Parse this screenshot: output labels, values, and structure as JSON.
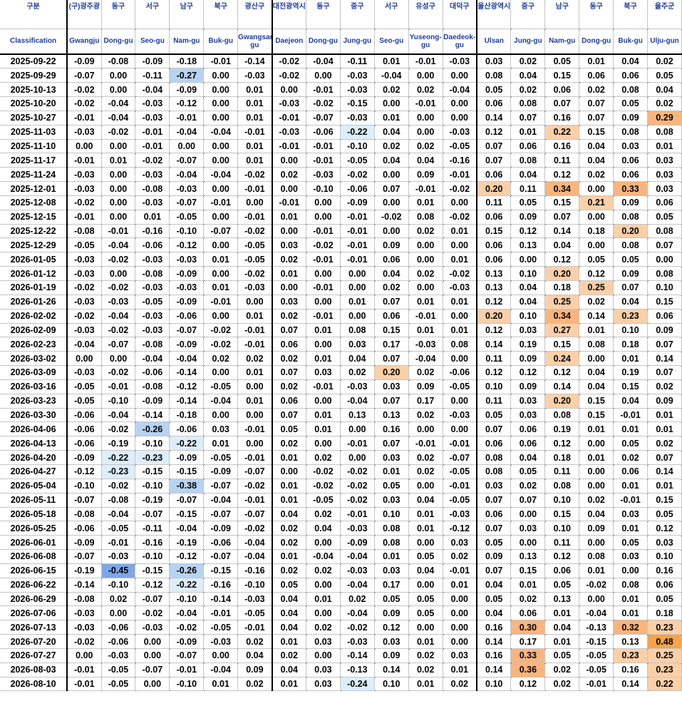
{
  "header_ko": [
    "구분",
    "(구)광주광",
    "동구",
    "서구",
    "남구",
    "북구",
    "광산구",
    "대전광역시",
    "동구",
    "중구",
    "서구",
    "유성구",
    "대덕구",
    "울산광역시",
    "중구",
    "남구",
    "동구",
    "북구",
    "울주군"
  ],
  "header_en": [
    "Classification",
    "Gwangju",
    "Dong-gu",
    "Seo-gu",
    "Nam-gu",
    "Buk-gu",
    "Gwangsan-gu",
    "Daejeon",
    "Dong-gu",
    "Jung-gu",
    "Seo-gu",
    "Yuseong-gu",
    "Daedeok-gu",
    "Ulsan",
    "Jung-gu",
    "Nam-gu",
    "Dong-gu",
    "Buk-gu",
    "Ulju-gun"
  ],
  "rows": [
    [
      "2025-09-22",
      "-0.09",
      "-0.08",
      "-0.09",
      "-0.18",
      "-0.01",
      "-0.14",
      "-0.02",
      "-0.04",
      "-0.11",
      "0.01",
      "-0.01",
      "-0.03",
      "0.03",
      "0.02",
      "0.05",
      "0.01",
      "0.04",
      "0.02"
    ],
    [
      "2025-09-29",
      "-0.07",
      "0.00",
      "-0.11",
      "-0.27",
      "0.00",
      "-0.03",
      "-0.02",
      "0.00",
      "-0.03",
      "-0.04",
      "0.00",
      "0.00",
      "0.08",
      "0.04",
      "0.15",
      "0.06",
      "0.06",
      "0.05"
    ],
    [
      "2025-10-13",
      "-0.02",
      "0.00",
      "-0.04",
      "-0.09",
      "0.00",
      "0.01",
      "0.00",
      "-0.01",
      "-0.03",
      "0.02",
      "0.02",
      "-0.04",
      "0.05",
      "0.02",
      "0.06",
      "0.02",
      "0.08",
      "0.04"
    ],
    [
      "2025-10-20",
      "-0.02",
      "-0.04",
      "-0.03",
      "-0.12",
      "0.00",
      "0.01",
      "-0.03",
      "-0.02",
      "-0.15",
      "0.00",
      "-0.01",
      "0.00",
      "0.06",
      "0.08",
      "0.07",
      "0.07",
      "0.05",
      "0.02"
    ],
    [
      "2025-10-27",
      "-0.01",
      "-0.04",
      "-0.03",
      "-0.01",
      "0.00",
      "0.01",
      "-0.01",
      "-0.07",
      "-0.03",
      "0.01",
      "0.00",
      "0.00",
      "0.14",
      "0.07",
      "0.16",
      "0.07",
      "0.09",
      "0.29"
    ],
    [
      "2025-11-03",
      "-0.03",
      "-0.02",
      "-0.01",
      "-0.04",
      "-0.04",
      "-0.01",
      "-0.03",
      "-0.06",
      "-0.22",
      "0.04",
      "0.00",
      "-0.03",
      "0.12",
      "0.01",
      "0.22",
      "0.15",
      "0.08",
      "0.08"
    ],
    [
      "2025-11-10",
      "0.00",
      "0.00",
      "-0.01",
      "0.00",
      "0.00",
      "0.01",
      "-0.01",
      "-0.01",
      "-0.10",
      "0.02",
      "0.02",
      "-0.05",
      "0.07",
      "0.06",
      "0.16",
      "0.04",
      "0.03",
      "0.01"
    ],
    [
      "2025-11-17",
      "-0.01",
      "0.01",
      "-0.02",
      "-0.07",
      "0.00",
      "0.01",
      "0.00",
      "-0.01",
      "-0.05",
      "0.04",
      "0.04",
      "-0.16",
      "0.07",
      "0.08",
      "0.11",
      "0.04",
      "0.06",
      "0.03"
    ],
    [
      "2025-11-24",
      "-0.03",
      "0.00",
      "-0.03",
      "-0.04",
      "-0.04",
      "-0.02",
      "0.02",
      "-0.03",
      "-0.02",
      "0.00",
      "0.09",
      "-0.01",
      "0.06",
      "0.04",
      "0.12",
      "0.02",
      "0.06",
      "0.03"
    ],
    [
      "2025-12-01",
      "-0.03",
      "0.00",
      "-0.08",
      "-0.03",
      "0.00",
      "-0.01",
      "0.00",
      "-0.10",
      "-0.06",
      "0.07",
      "-0.01",
      "-0.02",
      "0.20",
      "0.11",
      "0.34",
      "0.00",
      "0.33",
      "0.03"
    ],
    [
      "2025-12-08",
      "-0.02",
      "0.00",
      "-0.03",
      "-0.07",
      "-0.01",
      "0.00",
      "-0.01",
      "0.00",
      "-0.09",
      "0.00",
      "0.01",
      "0.00",
      "0.11",
      "0.05",
      "0.15",
      "0.21",
      "0.09",
      "0.06"
    ],
    [
      "2025-12-15",
      "-0.01",
      "0.00",
      "0.01",
      "-0.05",
      "0.00",
      "-0.01",
      "0.01",
      "0.00",
      "-0.01",
      "-0.02",
      "0.08",
      "-0.02",
      "0.06",
      "0.09",
      "0.07",
      "0.00",
      "0.08",
      "0.05"
    ],
    [
      "2025-12-22",
      "-0.08",
      "-0.01",
      "-0.16",
      "-0.10",
      "-0.07",
      "-0.02",
      "0.00",
      "-0.01",
      "-0.01",
      "0.00",
      "0.02",
      "0.01",
      "0.15",
      "0.12",
      "0.14",
      "0.18",
      "0.20",
      "0.08"
    ],
    [
      "2025-12-29",
      "-0.05",
      "-0.04",
      "-0.06",
      "-0.12",
      "0.00",
      "-0.05",
      "0.03",
      "-0.02",
      "-0.01",
      "0.09",
      "0.00",
      "0.00",
      "0.06",
      "0.13",
      "0.04",
      "0.00",
      "0.08",
      "0.07"
    ],
    [
      "2026-01-05",
      "-0.03",
      "-0.02",
      "-0.03",
      "-0.03",
      "0.01",
      "-0.05",
      "0.02",
      "-0.01",
      "-0.01",
      "0.06",
      "0.00",
      "0.01",
      "0.06",
      "0.00",
      "0.12",
      "0.05",
      "0.05",
      "0.00"
    ],
    [
      "2026-01-12",
      "-0.03",
      "0.00",
      "-0.08",
      "-0.09",
      "0.00",
      "-0.02",
      "0.01",
      "0.00",
      "0.00",
      "0.04",
      "0.02",
      "-0.02",
      "0.13",
      "0.10",
      "0.20",
      "0.12",
      "0.09",
      "0.08"
    ],
    [
      "2026-01-19",
      "-0.02",
      "-0.02",
      "-0.03",
      "-0.03",
      "0.01",
      "-0.03",
      "0.00",
      "-0.01",
      "0.00",
      "0.02",
      "0.00",
      "-0.03",
      "0.13",
      "0.04",
      "0.18",
      "0.25",
      "0.07",
      "0.10"
    ],
    [
      "2026-01-26",
      "-0.03",
      "-0.03",
      "-0.05",
      "-0.09",
      "-0.01",
      "0.00",
      "0.03",
      "0.00",
      "0.01",
      "0.07",
      "0.01",
      "0.01",
      "0.12",
      "0.04",
      "0.25",
      "0.02",
      "0.04",
      "0.15"
    ],
    [
      "2026-02-02",
      "-0.02",
      "-0.04",
      "-0.03",
      "-0.06",
      "0.00",
      "0.01",
      "0.02",
      "-0.01",
      "0.00",
      "0.06",
      "-0.01",
      "0.00",
      "0.20",
      "0.10",
      "0.34",
      "0.14",
      "0.23",
      "0.06"
    ],
    [
      "2026-02-09",
      "-0.03",
      "-0.02",
      "-0.03",
      "-0.07",
      "-0.02",
      "-0.01",
      "0.07",
      "0.01",
      "0.08",
      "0.15",
      "0.01",
      "0.01",
      "0.12",
      "0.03",
      "0.27",
      "0.01",
      "0.10",
      "0.09"
    ],
    [
      "2026-02-23",
      "-0.04",
      "-0.07",
      "-0.08",
      "-0.09",
      "-0.02",
      "-0.01",
      "0.06",
      "0.00",
      "0.03",
      "0.17",
      "-0.03",
      "0.08",
      "0.14",
      "0.19",
      "0.15",
      "0.08",
      "0.18",
      "0.07"
    ],
    [
      "2026-03-02",
      "0.00",
      "0.00",
      "-0.04",
      "-0.04",
      "0.02",
      "0.02",
      "0.02",
      "0.01",
      "0.04",
      "0.07",
      "-0.04",
      "0.00",
      "0.11",
      "0.09",
      "0.24",
      "0.00",
      "0.01",
      "0.14"
    ],
    [
      "2026-03-09",
      "-0.03",
      "-0.02",
      "-0.06",
      "-0.14",
      "0.00",
      "0.01",
      "0.07",
      "0.03",
      "0.02",
      "0.20",
      "0.02",
      "-0.06",
      "0.12",
      "0.12",
      "0.12",
      "0.04",
      "0.19",
      "0.07"
    ],
    [
      "2026-03-16",
      "-0.05",
      "-0.01",
      "-0.08",
      "-0.12",
      "-0.05",
      "0.00",
      "0.02",
      "-0.01",
      "-0.03",
      "0.03",
      "0.09",
      "-0.05",
      "0.10",
      "0.09",
      "0.14",
      "0.04",
      "0.15",
      "0.02"
    ],
    [
      "2026-03-23",
      "-0.05",
      "-0.10",
      "-0.09",
      "-0.14",
      "-0.04",
      "0.01",
      "0.06",
      "0.00",
      "-0.04",
      "0.07",
      "0.17",
      "0.00",
      "0.11",
      "0.03",
      "0.20",
      "0.15",
      "0.04",
      "0.09"
    ],
    [
      "2026-03-30",
      "-0.06",
      "-0.04",
      "-0.14",
      "-0.18",
      "0.00",
      "0.00",
      "0.07",
      "0.01",
      "0.13",
      "0.13",
      "0.02",
      "-0.03",
      "0.05",
      "0.03",
      "0.08",
      "0.15",
      "-0.01",
      "0.01"
    ],
    [
      "2026-04-06",
      "-0.06",
      "-0.02",
      "-0.26",
      "-0.06",
      "0.03",
      "-0.01",
      "0.05",
      "0.01",
      "0.00",
      "0.16",
      "0.00",
      "0.00",
      "0.07",
      "0.06",
      "0.19",
      "0.01",
      "0.01",
      "0.01"
    ],
    [
      "2026-04-13",
      "-0.06",
      "-0.19",
      "-0.10",
      "-0.22",
      "0.01",
      "0.00",
      "0.02",
      "0.00",
      "-0.01",
      "0.07",
      "-0.01",
      "-0.01",
      "0.06",
      "0.06",
      "0.12",
      "0.00",
      "0.05",
      "0.02"
    ],
    [
      "2026-04-20",
      "-0.09",
      "-0.22",
      "-0.23",
      "-0.09",
      "-0.05",
      "-0.01",
      "0.01",
      "0.02",
      "0.00",
      "0.03",
      "0.02",
      "-0.07",
      "0.08",
      "0.04",
      "0.18",
      "0.01",
      "0.02",
      "0.07"
    ],
    [
      "2026-04-27",
      "-0.12",
      "-0.23",
      "-0.15",
      "-0.15",
      "-0.09",
      "-0.07",
      "0.00",
      "-0.02",
      "-0.02",
      "0.01",
      "0.02",
      "-0.05",
      "0.08",
      "0.05",
      "0.11",
      "0.00",
      "0.06",
      "0.14"
    ],
    [
      "2026-05-04",
      "-0.10",
      "-0.02",
      "-0.10",
      "-0.38",
      "-0.07",
      "-0.02",
      "0.01",
      "-0.02",
      "-0.02",
      "0.05",
      "0.00",
      "-0.01",
      "0.03",
      "0.02",
      "0.08",
      "0.00",
      "0.01",
      "0.01"
    ],
    [
      "2026-05-11",
      "-0.07",
      "-0.08",
      "-0.19",
      "-0.07",
      "-0.04",
      "-0.01",
      "0.01",
      "-0.05",
      "-0.02",
      "0.03",
      "0.04",
      "-0.05",
      "0.07",
      "0.07",
      "0.10",
      "0.02",
      "-0.01",
      "0.15"
    ],
    [
      "2026-05-18",
      "-0.08",
      "-0.04",
      "-0.07",
      "-0.15",
      "-0.07",
      "-0.07",
      "0.04",
      "0.02",
      "-0.01",
      "0.10",
      "0.01",
      "-0.03",
      "0.06",
      "0.00",
      "0.15",
      "0.04",
      "0.03",
      "0.05"
    ],
    [
      "2026-05-25",
      "-0.06",
      "-0.05",
      "-0.11",
      "-0.04",
      "-0.09",
      "-0.02",
      "0.02",
      "0.04",
      "-0.03",
      "0.08",
      "0.01",
      "-0.12",
      "0.07",
      "0.03",
      "0.10",
      "0.09",
      "0.01",
      "0.12"
    ],
    [
      "2026-06-01",
      "-0.09",
      "-0.01",
      "-0.16",
      "-0.19",
      "-0.06",
      "-0.04",
      "0.02",
      "0.00",
      "-0.09",
      "0.08",
      "0.00",
      "0.03",
      "0.05",
      "0.00",
      "0.11",
      "0.00",
      "0.05",
      "0.03"
    ],
    [
      "2026-06-08",
      "-0.07",
      "-0.03",
      "-0.10",
      "-0.12",
      "-0.07",
      "-0.04",
      "0.01",
      "-0.04",
      "-0.04",
      "0.01",
      "0.05",
      "0.02",
      "0.09",
      "0.13",
      "0.12",
      "0.08",
      "0.03",
      "0.10"
    ],
    [
      "2026-06-15",
      "-0.19",
      "-0.45",
      "-0.15",
      "-0.26",
      "-0.15",
      "-0.16",
      "0.02",
      "0.02",
      "-0.03",
      "0.03",
      "0.04",
      "-0.01",
      "0.07",
      "0.15",
      "0.06",
      "0.01",
      "0.00",
      "0.16"
    ],
    [
      "2026-06-22",
      "-0.14",
      "-0.10",
      "-0.12",
      "-0.22",
      "-0.16",
      "-0.10",
      "0.05",
      "0.00",
      "-0.04",
      "0.17",
      "0.00",
      "0.01",
      "0.04",
      "0.01",
      "0.05",
      "-0.02",
      "0.08",
      "0.06"
    ],
    [
      "2026-06-29",
      "-0.08",
      "0.02",
      "-0.07",
      "-0.10",
      "-0.14",
      "-0.03",
      "0.04",
      "0.01",
      "0.02",
      "0.05",
      "0.05",
      "0.00",
      "0.05",
      "0.02",
      "0.13",
      "0.00",
      "0.01",
      "0.05"
    ],
    [
      "2026-07-06",
      "-0.03",
      "0.00",
      "-0.02",
      "-0.04",
      "-0.01",
      "-0.05",
      "0.04",
      "0.00",
      "-0.04",
      "0.09",
      "0.05",
      "0.00",
      "0.04",
      "0.06",
      "0.01",
      "-0.04",
      "0.01",
      "0.18"
    ],
    [
      "2026-07-13",
      "-0.03",
      "-0.06",
      "-0.03",
      "-0.02",
      "-0.05",
      "-0.01",
      "0.04",
      "0.02",
      "-0.02",
      "0.12",
      "0.00",
      "0.00",
      "0.16",
      "0.30",
      "0.04",
      "-0.13",
      "0.32",
      "0.23"
    ],
    [
      "2026-07-20",
      "-0.02",
      "-0.06",
      "0.00",
      "-0.09",
      "-0.03",
      "0.02",
      "0.01",
      "0.03",
      "-0.03",
      "0.03",
      "0.01",
      "0.00",
      "0.14",
      "0.17",
      "0.01",
      "-0.15",
      "0.13",
      "0.48"
    ],
    [
      "2026-07-27",
      "0.00",
      "-0.03",
      "0.00",
      "-0.07",
      "0.00",
      "0.04",
      "0.02",
      "0.00",
      "-0.14",
      "0.09",
      "0.02",
      "0.03",
      "0.16",
      "0.33",
      "0.05",
      "-0.05",
      "0.23",
      "0.25"
    ],
    [
      "2026-08-03",
      "-0.01",
      "-0.05",
      "-0.07",
      "-0.01",
      "-0.04",
      "0.09",
      "0.04",
      "0.03",
      "-0.13",
      "0.14",
      "0.02",
      "0.01",
      "0.14",
      "0.36",
      "0.02",
      "-0.05",
      "0.16",
      "0.23"
    ],
    [
      "2026-08-10",
      "-0.01",
      "-0.05",
      "0.00",
      "-0.10",
      "0.01",
      "0.02",
      "0.01",
      "0.03",
      "-0.24",
      "0.10",
      "0.01",
      "0.02",
      "0.10",
      "0.12",
      "0.02",
      "-0.01",
      "0.14",
      "0.22"
    ]
  ],
  "colors": {
    "header_text": "#1f3e9e",
    "neg_light": "#ddeefa",
    "neg_mid": "#b7d3f2",
    "neg_strong": "#7da7e6",
    "pos_light": "#fbd0a8",
    "pos_mid": "#f9b57d",
    "pos_strong": "#f7a346"
  }
}
